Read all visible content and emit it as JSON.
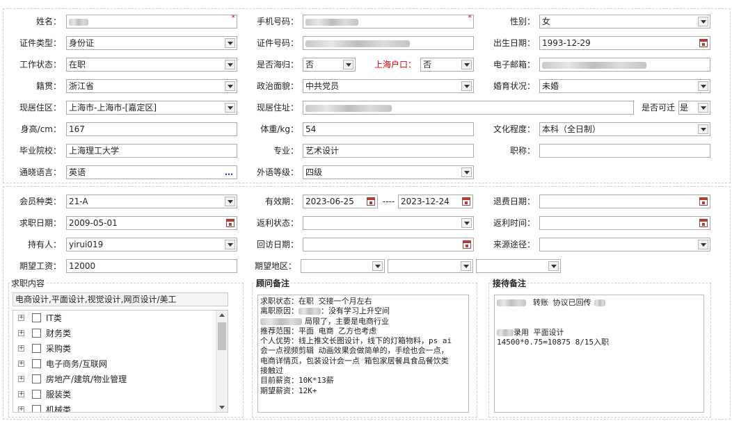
{
  "basic": {
    "name": {
      "label": "姓名："
    },
    "mobile": {
      "label": "手机号码："
    },
    "gender": {
      "label": "性别：",
      "value": "女"
    },
    "id_type": {
      "label": "证件类型：",
      "value": "身份证"
    },
    "id_number": {
      "label": "证件号码："
    },
    "birth_date": {
      "label": "出生日期：",
      "value": "1993-12-29"
    },
    "work_status": {
      "label": "工作状态：",
      "value": "在职"
    },
    "returnee": {
      "label": "是否海归：",
      "value": "否"
    },
    "shanghai_hukou": {
      "label": "上海户口：",
      "value": "否"
    },
    "email": {
      "label": "电子邮箱："
    },
    "native_place": {
      "label": "籍贯：",
      "value": "浙江省"
    },
    "political": {
      "label": "政治面貌：",
      "value": "中共党员"
    },
    "marital": {
      "label": "婚育状况：",
      "value": "未婚"
    },
    "residence_area": {
      "label": "现居住区：",
      "value": "上海市-上海市-[嘉定区]"
    },
    "residence_address": {
      "label": "现居住址："
    },
    "relocate": {
      "label": "是否可迁",
      "value": "是"
    },
    "height": {
      "label": "身高/cm：",
      "value": "167"
    },
    "weight": {
      "label": "体重/kg：",
      "value": "54"
    },
    "education": {
      "label": "文化程度：",
      "value": "本科（全日制）"
    },
    "school": {
      "label": "毕业院校：",
      "value": "上海理工大学"
    },
    "major": {
      "label": "专业：",
      "value": "艺术设计"
    },
    "title": {
      "label": "职称：",
      "value": ""
    },
    "language": {
      "label": "通晓语言：",
      "value": "英语",
      "more_icon": "…"
    },
    "foreign_level": {
      "label": "外语等级：",
      "value": "四级"
    }
  },
  "membership": {
    "type": {
      "label": "会员种类：",
      "value": "21-A"
    },
    "valid": {
      "label": "有效期：",
      "start": "2023-06-25",
      "separator": "----",
      "end": "2023-12-24"
    },
    "refund_date": {
      "label": "退费日期：",
      "value": ""
    },
    "job_date": {
      "label": "求职日期：",
      "value": "2009-05-01"
    },
    "rebate_status": {
      "label": "返利状态：",
      "value": ""
    },
    "rebate_time": {
      "label": "返利时间：",
      "value": ""
    },
    "holder": {
      "label": "持有人：",
      "value": "yirui019"
    },
    "revisit_date": {
      "label": "回访日期：",
      "value": ""
    },
    "source": {
      "label": "来源途径：",
      "value": ""
    },
    "expected_salary": {
      "label": "期望工资：",
      "value": "12000"
    },
    "expected_region": {
      "label": "期望地区：",
      "values": [
        "",
        "",
        ""
      ]
    }
  },
  "job_content": {
    "title": "求职内容",
    "selected": "电商设计,平面设计,视觉设计,网页设计/美工",
    "tree": [
      {
        "label": "IT类"
      },
      {
        "label": "财务类"
      },
      {
        "label": "采购类"
      },
      {
        "label": "电子商务/互联网"
      },
      {
        "label": "房地产/建筑/物业管理"
      },
      {
        "label": "服装类"
      },
      {
        "label": "机械类"
      }
    ],
    "expander_glyph": "+"
  },
  "consultant_notes": {
    "title": "顾问备注",
    "lines": [
      "求职状态：在职  交接一个月左右",
      "离职原因：",
      "：没有学习上升空间",
      "局限了，主要是电商行业",
      "推荐范围：平面  电商    乙方也考虑",
      "个人优势：线上推文长图设计，线下的灯箱物料，ps ai",
      "会一点视频剪辑 动画效果会做简单的，手绘也会一点，",
      "电商详情页，包装设计会一点 箱包家居餐具食品餐饮类",
      "接触过",
      "目前薪资：10K*13薪",
      "期望薪资：12K+"
    ]
  },
  "reception_notes": {
    "title": "接待备注",
    "lines": [
      "转账  协议已回传",
      "录用 平面设计",
      "14500*0.75=10875  8/15入职"
    ]
  },
  "colors": {
    "required": "#d80000",
    "hukou_label": "#d80000",
    "calendar_icon": "#c0392b"
  }
}
